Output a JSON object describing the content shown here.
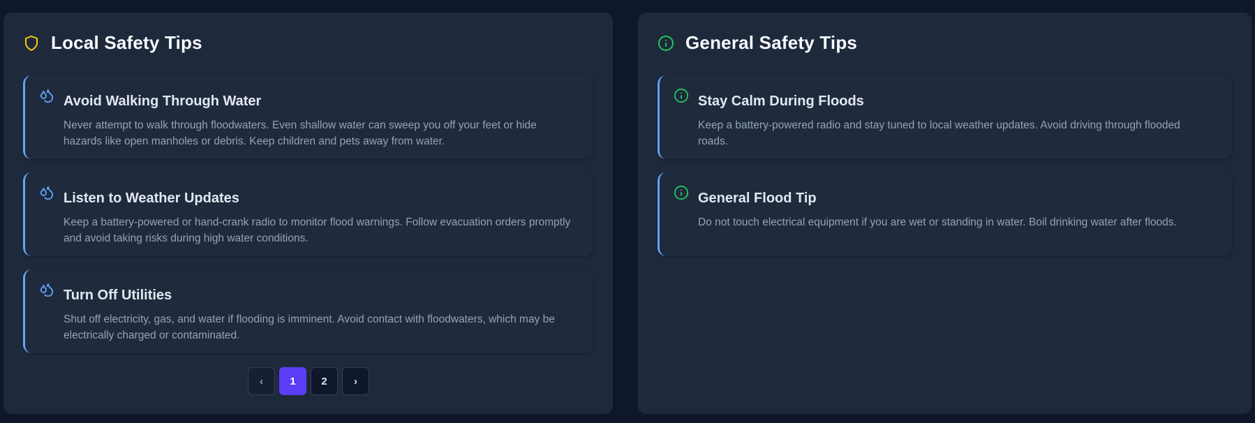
{
  "local": {
    "title": "Local Safety Tips",
    "icon": "shield-icon",
    "tips": [
      {
        "icon": "water-drops-icon",
        "title": "Avoid Walking Through Water",
        "body": "Never attempt to walk through floodwaters. Even shallow water can sweep you off your feet or hide hazards like open manholes or debris. Keep children and pets away from water."
      },
      {
        "icon": "water-drops-icon",
        "title": "Listen to Weather Updates",
        "body": "Keep a battery-powered or hand-crank radio to monitor flood warnings. Follow evacuation orders promptly and avoid taking risks during high water conditions."
      },
      {
        "icon": "water-drops-icon",
        "title": "Turn Off Utilities",
        "body": "Shut off electricity, gas, and water if flooding is imminent. Avoid contact with floodwaters, which may be electrically charged or contaminated."
      }
    ],
    "pagination": {
      "prev": "‹",
      "pages": [
        "1",
        "2"
      ],
      "next": "›",
      "current": "1"
    }
  },
  "general": {
    "title": "General Safety Tips",
    "icon": "info-icon",
    "tips": [
      {
        "icon": "info-icon",
        "title": "Stay Calm During Floods",
        "body": "Keep a battery-powered radio and stay tuned to local weather updates. Avoid driving through flooded roads."
      },
      {
        "icon": "info-icon",
        "title": "General Flood Tip",
        "body": "Do not touch electrical equipment if you are wet or standing in water. Boil drinking water after floods."
      }
    ]
  },
  "colors": {
    "background": "#0f172a",
    "panel": "#1e293b",
    "accent_blue": "#60a5fa",
    "shield_yellow": "#facc15",
    "info_green": "#22c55e",
    "active_page": "#5b3df5"
  }
}
